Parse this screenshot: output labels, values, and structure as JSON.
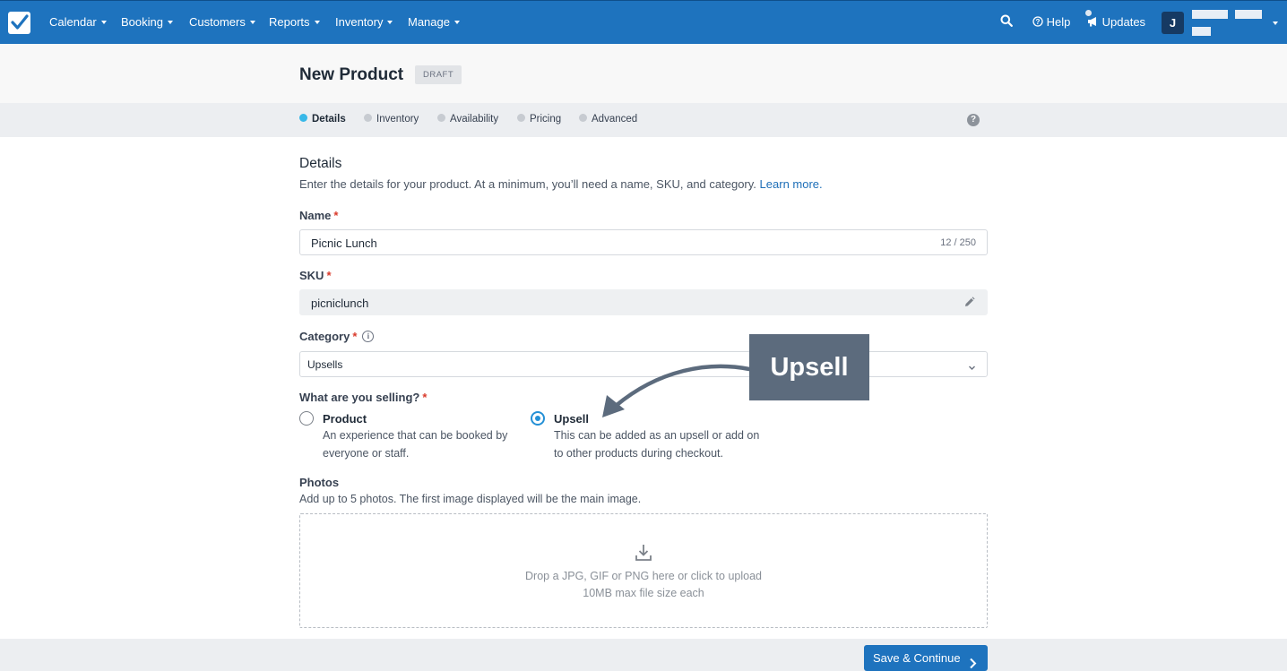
{
  "nav": {
    "items": [
      {
        "label": "Calendar"
      },
      {
        "label": "Booking"
      },
      {
        "label": "Customers"
      },
      {
        "label": "Reports"
      },
      {
        "label": "Inventory"
      },
      {
        "label": "Manage"
      }
    ],
    "help_label": "Help",
    "updates_label": "Updates",
    "avatar_initial": "J"
  },
  "header": {
    "title": "New Product",
    "badge": "DRAFT"
  },
  "steps": [
    {
      "label": "Details",
      "active": true
    },
    {
      "label": "Inventory",
      "active": false
    },
    {
      "label": "Availability",
      "active": false
    },
    {
      "label": "Pricing",
      "active": false
    },
    {
      "label": "Advanced",
      "active": false
    }
  ],
  "help_glyph": "?",
  "details": {
    "title": "Details",
    "description": "Enter the details for your product. At a minimum, you’ll need a name, SKU, and category.",
    "learn_more": "Learn more."
  },
  "form": {
    "name_label": "Name",
    "name_value": "Picnic Lunch",
    "name_counter": "12 / 250",
    "sku_label": "SKU",
    "sku_value": "picniclunch",
    "category_label": "Category",
    "category_value": "Upsells",
    "required_mark": "*",
    "selling_label": "What are you selling?",
    "options": [
      {
        "title": "Product",
        "desc": "An experience that can be booked by everyone or staff.",
        "checked": false
      },
      {
        "title": "Upsell",
        "desc": "This can be added as an upsell or add on to other products during checkout.",
        "checked": true
      }
    ],
    "photos_label": "Photos",
    "photos_desc": "Add up to 5 photos. The first image displayed will be the main image.",
    "dropzone_line1": "Drop a JPG, GIF or PNG here or click to upload",
    "dropzone_line2": "10MB max file size each"
  },
  "footer": {
    "save_label": "Save & Continue"
  },
  "callout": {
    "text": "Upsell"
  },
  "colors": {
    "nav_bg": "#1e73be",
    "active_step": "#38b8e8",
    "radio_checked": "#2490d6",
    "required": "#d93a2b",
    "callout_bg": "#5c6b7d"
  },
  "icons": [
    "check-logo-icon",
    "caret-down-icon",
    "search-icon",
    "help-circle-icon",
    "megaphone-icon",
    "pencil-icon",
    "info-icon",
    "chevron-down-icon",
    "download-icon",
    "chevron-right-icon",
    "curved-arrow-icon"
  ]
}
